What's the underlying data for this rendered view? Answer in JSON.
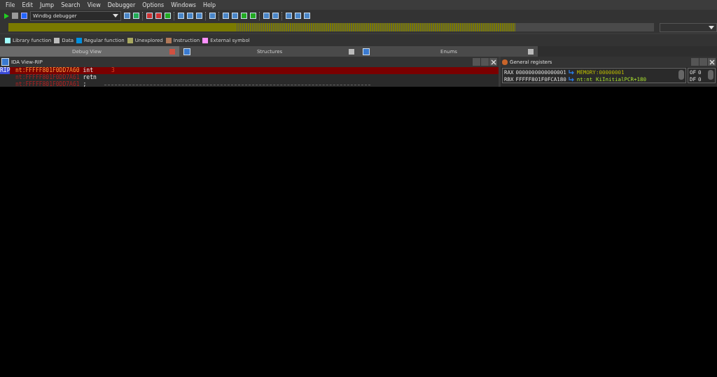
{
  "menu": [
    "File",
    "Edit",
    "Jump",
    "Search",
    "View",
    "Debugger",
    "Options",
    "Windows",
    "Help"
  ],
  "toolbar": {
    "debugger": "Windbg debugger"
  },
  "legend": [
    {
      "label": "Library function",
      "color": "#a0ffff"
    },
    {
      "label": "Data",
      "color": "#bcbcbc"
    },
    {
      "label": "Regular function",
      "color": "#0090e0"
    },
    {
      "label": "Unexplored",
      "color": "#a8a860"
    },
    {
      "label": "Instruction",
      "color": "#b07858"
    },
    {
      "label": "External symbol",
      "color": "#ff90ff"
    }
  ],
  "tabs": [
    {
      "label": "Debug View",
      "selected": true
    },
    {
      "label": "Structures",
      "selected": false
    },
    {
      "label": "Enums",
      "selected": false
    }
  ],
  "ida_view": {
    "title": "IDA View-RIP",
    "rip": "RIP",
    "lines": [
      {
        "address": "nt:FFFFF801F0DD7A60",
        "mnemonic": "int",
        "operand": "3",
        "selected": true
      },
      {
        "address": "nt:FFFFF801F0DD7A61",
        "mnemonic": "retn",
        "selected": false
      },
      {
        "address": "nt:FFFFF801F0DD7A61",
        "mnemonic": ";",
        "selected": false
      }
    ]
  },
  "registers": {
    "title": "General registers",
    "rows": [
      {
        "name": "RAX",
        "value": "0000000000000001",
        "target": "MEMORY:00000001"
      },
      {
        "name": "RBX",
        "value": "FFFFF801F0FCA180",
        "target": "nt:nt KiInitialPCR+180"
      }
    ],
    "flags": [
      {
        "name": "OF",
        "value": "0"
      },
      {
        "name": "DF",
        "value": "0"
      }
    ]
  }
}
